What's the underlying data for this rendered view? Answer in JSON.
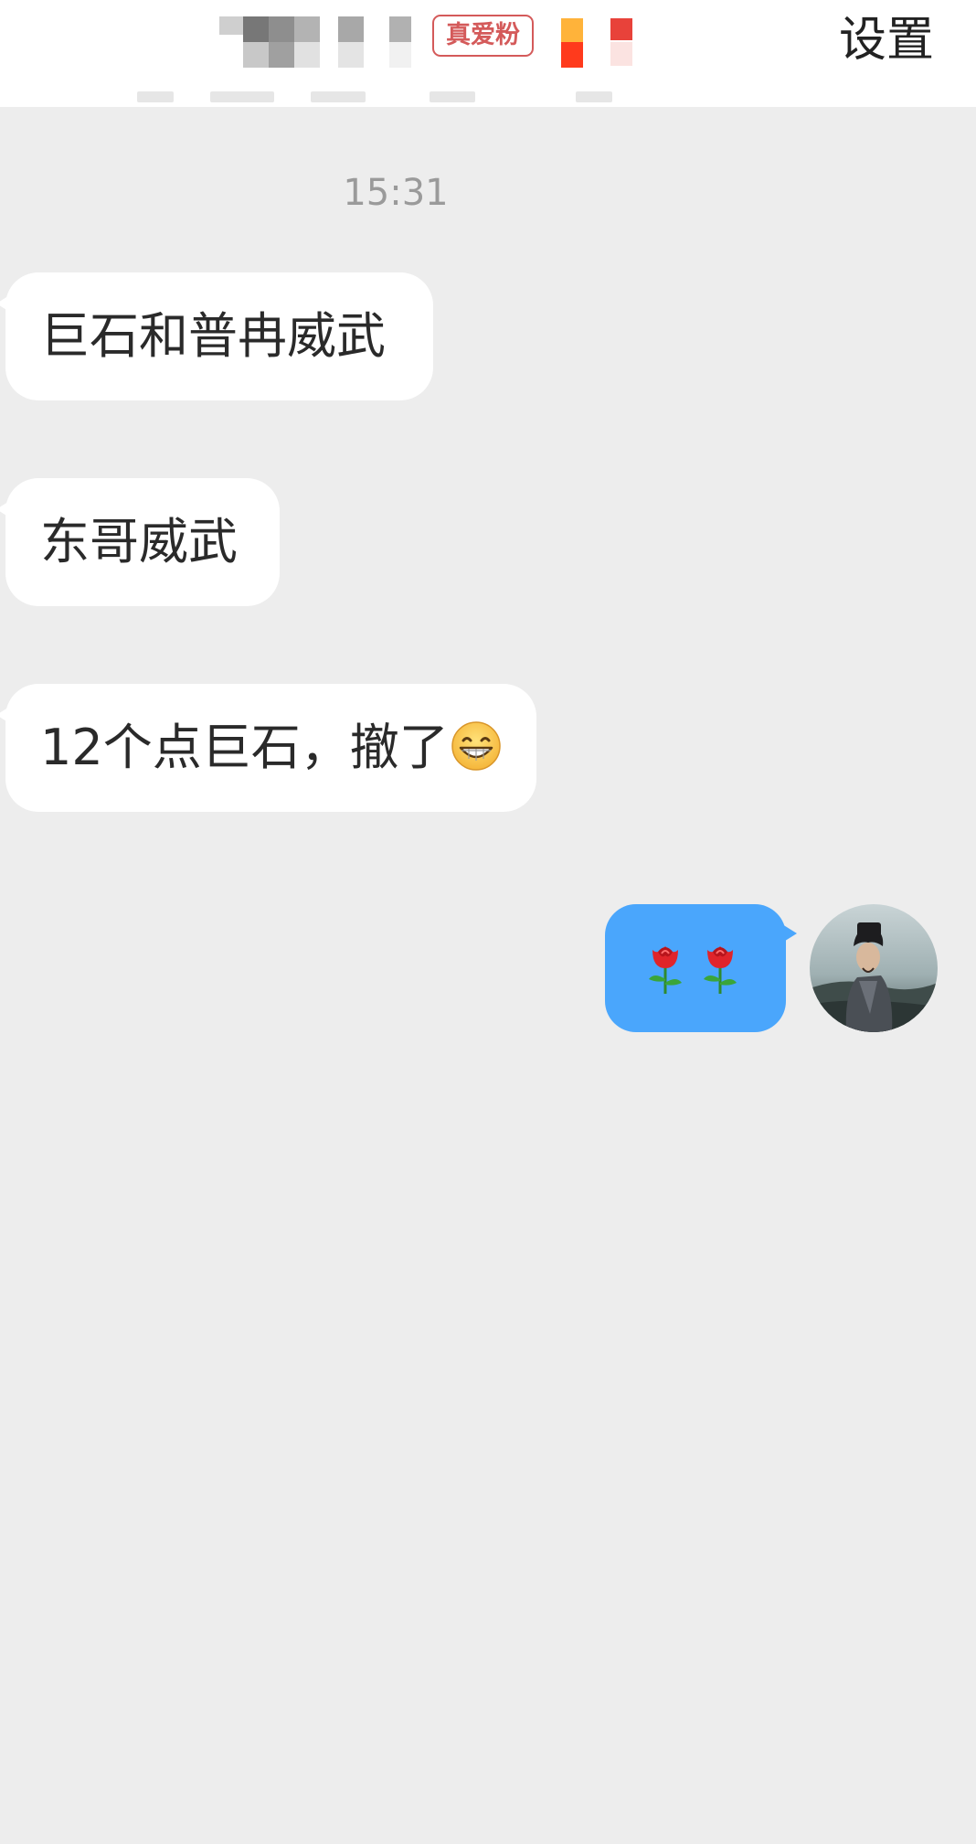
{
  "header": {
    "fan_badge": "真爱粉",
    "settings_label": "设置"
  },
  "chat": {
    "timestamp": "15:31",
    "incoming": [
      {
        "text": "巨石和普冉威武",
        "has_emoji": false
      },
      {
        "text": "东哥威武",
        "has_emoji": false
      },
      {
        "text": "12个点巨石，撤了",
        "has_emoji": true,
        "emoji": "grinning-face-icon"
      }
    ],
    "outgoing": [
      {
        "emoji": [
          "rose-icon",
          "rose-icon"
        ]
      }
    ]
  },
  "colors": {
    "background": "#ededed",
    "incoming_bubble": "#ffffff",
    "outgoing_bubble": "#4aa6fc",
    "badge": "#d45a5a"
  }
}
